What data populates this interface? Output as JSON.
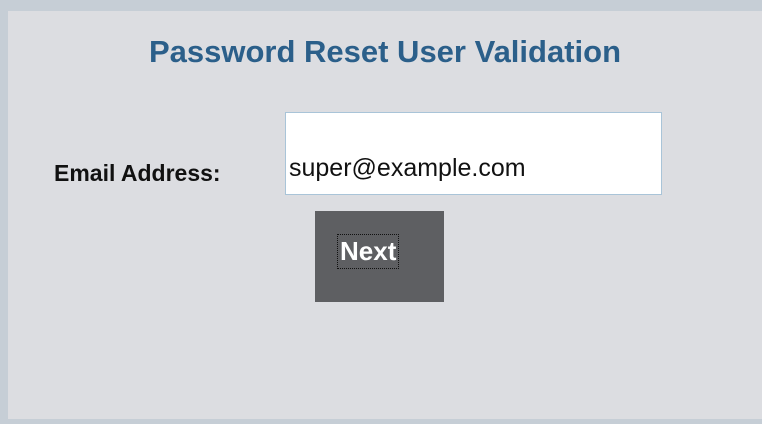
{
  "form": {
    "title": "Password Reset User Validation",
    "email_label": "Email Address:",
    "email_value": "super@example.com",
    "next_label": "Next"
  },
  "colors": {
    "page_background": "#c6ced6",
    "panel_background": "#dcdde1",
    "title": "#2b5f8a",
    "button_background": "#5e5f62",
    "button_text": "#ffffff",
    "input_border": "#a9c4d8"
  }
}
